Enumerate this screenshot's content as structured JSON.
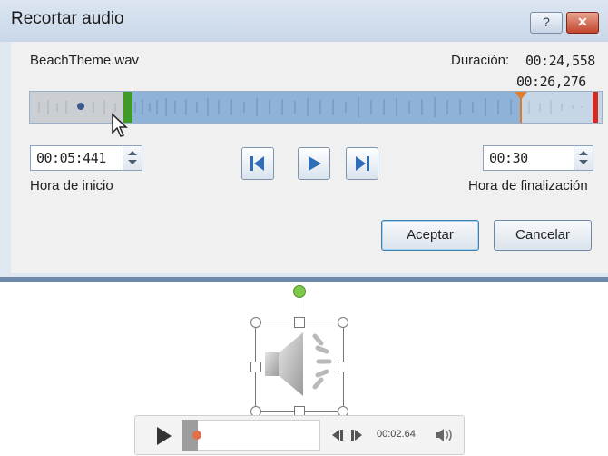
{
  "dialog": {
    "title": "Recortar audio",
    "help_label": "?",
    "close_label": "✕",
    "file_name": "BeachTheme.wav",
    "duration_label": "Duración:",
    "duration_value": "00:24,558",
    "current_position": "00:26,276",
    "start_time": {
      "value": "00:05:441",
      "label": "Hora de inicio"
    },
    "end_time": {
      "value": "00:30",
      "label": "Hora de finalización"
    },
    "ok_label": "Aceptar",
    "cancel_label": "Cancelar"
  },
  "player": {
    "time": "00:02.64"
  },
  "colors": {
    "start_marker": "#3f9a2a",
    "end_marker": "#d22b21",
    "position_marker": "#e07f2e",
    "waveform_selected": "#8fb2d8"
  },
  "icons": [
    "help-icon",
    "close-icon",
    "previous-frame-icon",
    "play-icon",
    "next-frame-icon",
    "speaker-icon",
    "volume-icon",
    "mouse-cursor-icon"
  ]
}
